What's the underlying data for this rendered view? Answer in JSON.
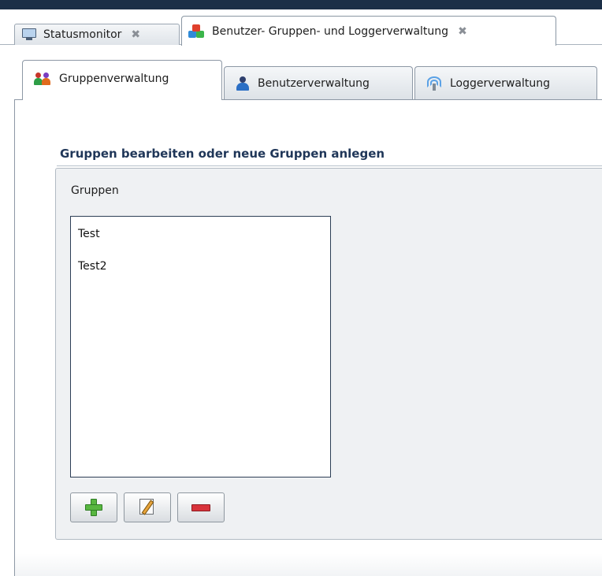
{
  "outer_tabs": [
    {
      "label": "Statusmonitor",
      "icon": "monitor-icon",
      "close": "✖"
    },
    {
      "label": "Benutzer- Gruppen- und Loggerverwaltung",
      "icon": "blocks-icon",
      "close": "✖"
    }
  ],
  "inner_tabs": [
    {
      "label": "Gruppenverwaltung",
      "icon": "users-icon",
      "active": true
    },
    {
      "label": "Benutzerverwaltung",
      "icon": "user-icon",
      "active": false
    },
    {
      "label": "Loggerverwaltung",
      "icon": "radio-icon",
      "active": false
    }
  ],
  "section": {
    "title": "Gruppen bearbeiten oder neue Gruppen anlegen",
    "group_label": "Gruppen"
  },
  "groups": [
    "Test",
    "Test2"
  ],
  "buttons": [
    {
      "name": "add",
      "icon": "plus-icon"
    },
    {
      "name": "edit",
      "icon": "pencil-icon"
    },
    {
      "name": "delete",
      "icon": "minus-icon"
    }
  ],
  "colors": {
    "topbar": "#1c2f47",
    "section_title": "#1f3658",
    "add": "#58b640",
    "delete": "#d8333b"
  }
}
